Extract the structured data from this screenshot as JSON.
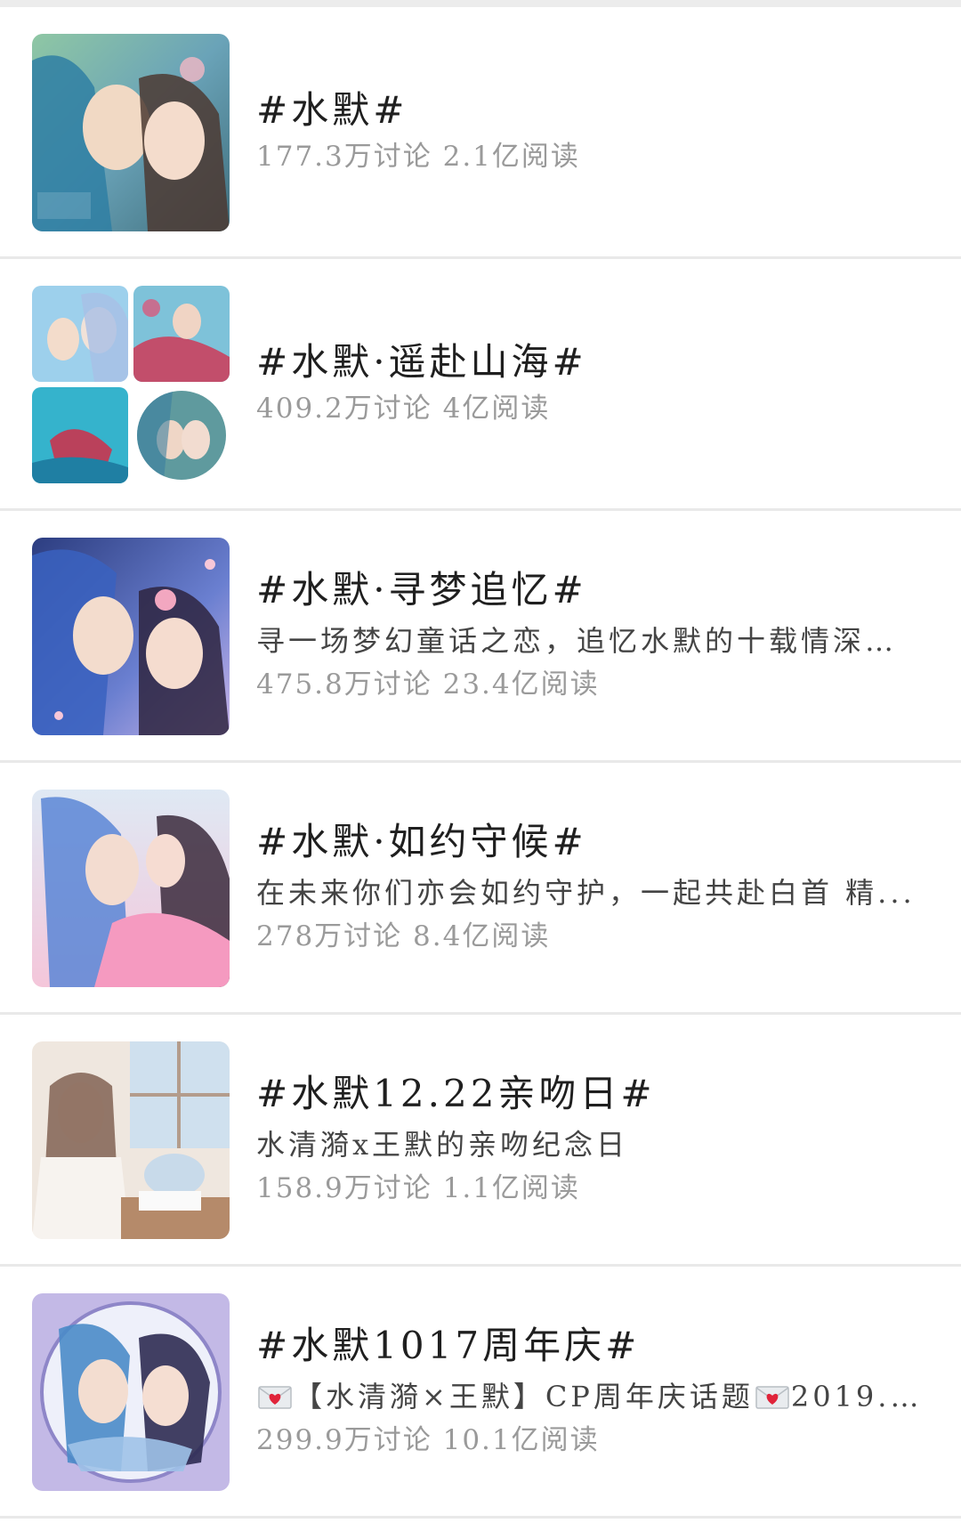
{
  "topics": [
    {
      "title": "#水默#",
      "description": "",
      "stats": "177.3万讨论 2.1亿阅读",
      "thumb": "single",
      "palette": [
        "#7fb6a8",
        "#3c7e9c",
        "#e8c9b5",
        "#5a7d5e"
      ]
    },
    {
      "title": "#水默·遥赴山海#",
      "description": "",
      "stats": "409.2万讨论 4亿阅读",
      "thumb": "grid",
      "palette": [
        "#8cc6e6",
        "#c65a73",
        "#3bb6d0",
        "#5f9a9e"
      ]
    },
    {
      "title": "#水默·寻梦追忆#",
      "description": "寻一场梦幻童话之恋，追忆水默的十载情深。...",
      "stats": "475.8万讨论 23.4亿阅读",
      "thumb": "single",
      "palette": [
        "#4058a8",
        "#8fa6e0",
        "#f2c6c9",
        "#2c3d80"
      ]
    },
    {
      "title": "#水默·如约守候#",
      "description": "在未来你们亦会如约守护，一起共赴白首 精...",
      "stats": "278万讨论 8.4亿阅读",
      "thumb": "single",
      "palette": [
        "#c8dcf0",
        "#5b86d6",
        "#f5a8c7",
        "#e7eef7"
      ]
    },
    {
      "title": "#水默12.22亲吻日#",
      "description": "水清漪x王默的亲吻纪念日",
      "stats": "158.9万讨论 1.1亿阅读",
      "thumb": "single",
      "palette": [
        "#f2ece6",
        "#b8d2e8",
        "#8c6a5a",
        "#dcd0c6"
      ]
    },
    {
      "title": "#水默1017周年庆#",
      "description_parts": [
        "【水清漪×王默】CP周年庆话题",
        "2019.10...."
      ],
      "stats": "299.9万讨论 10.1亿阅读",
      "thumb": "single",
      "palette": [
        "#b8b0e0",
        "#4a8bc8",
        "#f4f0f8",
        "#7f70b8"
      ]
    }
  ],
  "icons": {
    "mail_heart": "envelope-heart-icon"
  },
  "colors": {
    "title": "#1f1f1f",
    "description": "#444444",
    "stats": "#9a9a9a",
    "divider": "#e9e9e9"
  }
}
